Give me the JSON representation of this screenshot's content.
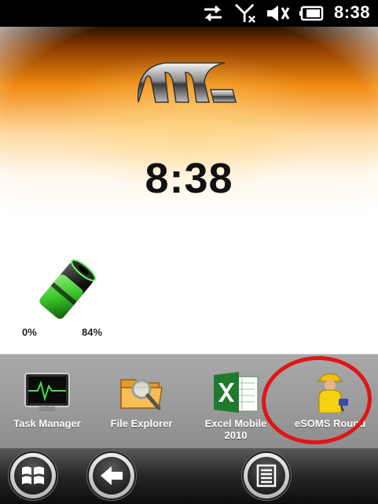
{
  "status_bar": {
    "time": "8:38",
    "icons": [
      "sync-arrows-icon",
      "no-signal-icon",
      "volume-muted-icon",
      "battery-icon"
    ]
  },
  "home": {
    "logo": "mc-logo",
    "clock": "8:38",
    "battery_widget": {
      "left_label": "0%",
      "right_label": "84%",
      "level_percent": 84
    }
  },
  "launcher": {
    "apps": [
      {
        "label": "Task Manager",
        "icon": "task-manager-icon"
      },
      {
        "label": "File Explorer",
        "icon": "file-explorer-icon"
      },
      {
        "label": "Excel Mobile\n2010",
        "icon": "excel-mobile-icon"
      },
      {
        "label": "eSOMS Round",
        "icon": "esoms-worker-icon"
      }
    ]
  },
  "taskbar": {
    "buttons": [
      "start-button",
      "back-button",
      "menu-button"
    ]
  },
  "colors": {
    "annotation": "#e01515",
    "excel_green": "#1f7a2e",
    "battery_green": "#39c42a"
  }
}
